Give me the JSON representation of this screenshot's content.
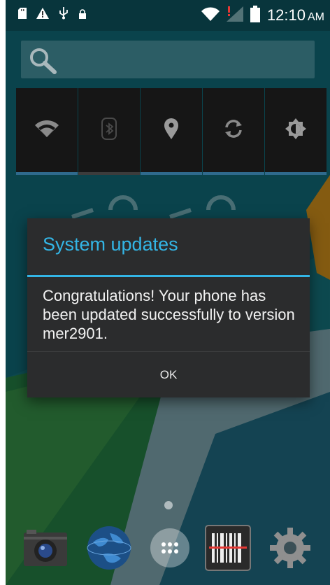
{
  "status_bar": {
    "time": "12:10",
    "am_pm": "AM",
    "icons": [
      "sd-card-icon",
      "warning-icon",
      "usb-icon",
      "lock-icon",
      "wifi-icon",
      "signal-no-service-icon",
      "battery-icon"
    ]
  },
  "search": {
    "icon": "search-icon"
  },
  "quick_settings": {
    "tiles": [
      {
        "icon": "wifi-icon",
        "state": "on"
      },
      {
        "icon": "bluetooth-icon",
        "state": "off"
      },
      {
        "icon": "location-icon",
        "state": "on"
      },
      {
        "icon": "sync-icon",
        "state": "on"
      },
      {
        "icon": "brightness-icon",
        "state": "on"
      }
    ]
  },
  "dialog": {
    "title": "System updates",
    "message": "Congratulations! Your phone has been updated successfully to version mer2901.",
    "ok_label": "OK",
    "accent_color": "#33b5e5"
  },
  "dock": {
    "apps": [
      "camera-icon",
      "browser-globe-icon",
      "app-drawer-icon",
      "barcode-scanner-icon",
      "settings-gear-icon"
    ]
  }
}
